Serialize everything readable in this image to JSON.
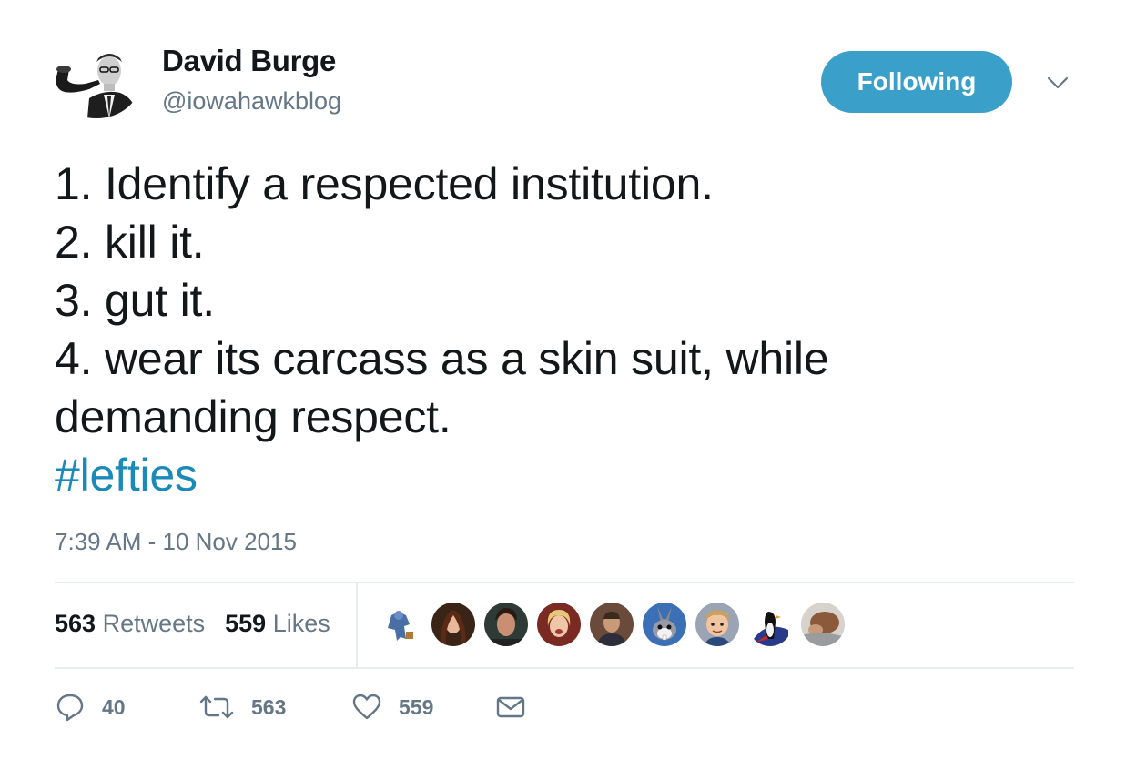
{
  "author": {
    "display_name": "David Burge",
    "handle": "@iowahawkblog"
  },
  "follow_button": {
    "label": "Following"
  },
  "tweet": {
    "lines": [
      "1. Identify a respected institution.",
      "2. kill it.",
      "3. gut it.",
      "4. wear its carcass as a skin suit, while",
      "demanding respect."
    ],
    "hashtag": "#lefties",
    "timestamp": "7:39 AM - 10 Nov 2015"
  },
  "stats": {
    "retweets_count": "563",
    "retweets_label": "Retweets",
    "likes_count": "559",
    "likes_label": "Likes"
  },
  "liker_avatars": [
    "liker-avatar-robot-figure",
    "liker-avatar-woman-dark-hair",
    "liker-avatar-woman-smiling",
    "liker-avatar-woman-blonde",
    "liker-avatar-man-portrait",
    "liker-avatar-cartoon-rabbit",
    "liker-avatar-cartoon-man",
    "liker-avatar-penguin-flag",
    "liker-avatar-animal-photo"
  ],
  "actions": {
    "reply_count": "40",
    "retweet_count": "563",
    "like_count": "559"
  },
  "colors": {
    "accent": "#3a9fc9",
    "hashtag": "#1b8ab8",
    "secondary_text": "#657786",
    "divider": "#e6ecf0"
  },
  "icons": [
    "caret-down-icon",
    "reply-icon",
    "retweet-icon",
    "heart-icon",
    "message-icon"
  ]
}
